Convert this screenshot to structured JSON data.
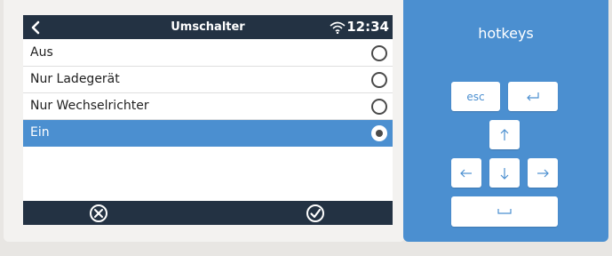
{
  "screen": {
    "title": "Umschalter",
    "time": "12:34",
    "options": [
      {
        "label": "Aus",
        "selected": false
      },
      {
        "label": "Nur Ladegerät",
        "selected": false
      },
      {
        "label": "Nur Wechselrichter",
        "selected": false
      },
      {
        "label": "Ein",
        "selected": true
      }
    ]
  },
  "hotkeys": {
    "title": "hotkeys",
    "esc_label": "esc",
    "enter_icon": "return-arrow-icon",
    "up_icon": "arrow-up-icon",
    "down_icon": "arrow-down-icon",
    "left_icon": "arrow-left-icon",
    "right_icon": "arrow-right-icon",
    "space_icon": "space-bar-icon"
  },
  "colors": {
    "bar": "#233243",
    "accent": "#4b8fd0"
  }
}
